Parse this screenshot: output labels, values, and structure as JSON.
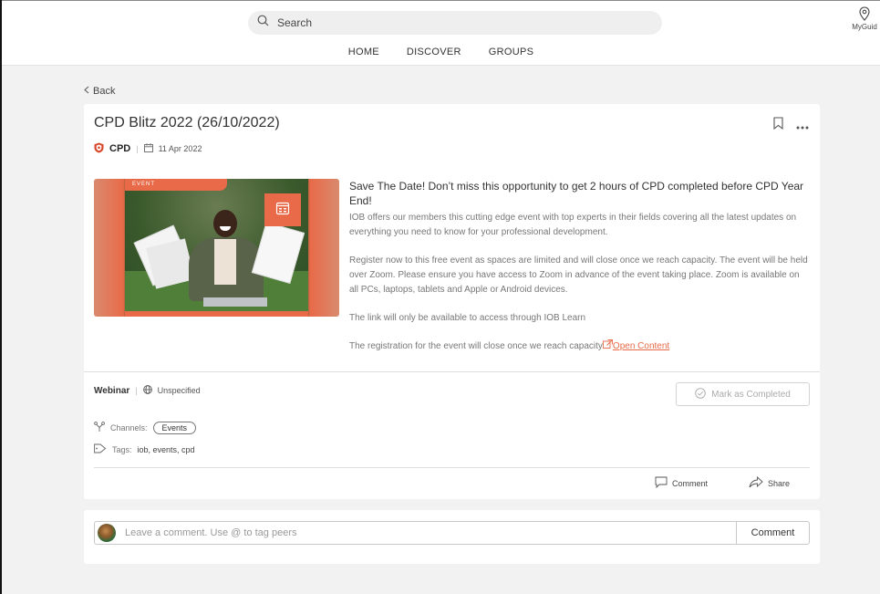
{
  "header": {
    "search_placeholder": "Search",
    "nav": [
      "HOME",
      "DISCOVER",
      "GROUPS"
    ],
    "myguide_label": "MyGuid"
  },
  "back_label": "Back",
  "content": {
    "title": "CPD Blitz 2022 (26/10/2022)",
    "provider": "CPD",
    "date": "11 Apr 2022",
    "image_tag": "EVENT",
    "lead": "Save The Date! Don’t miss this opportunity to get 2 hours of CPD completed before CPD Year End!",
    "paragraphs": [
      "IOB offers our members this cutting edge event with top experts in their fields covering all the latest updates on everything you need to know for your professional development.",
      "Register now to this free event as spaces are limited and will close once we reach capacity. The event will be held over Zoom. Please ensure you have access to Zoom in advance of the event taking place. Zoom is available on all PCs, laptops, tablets and Apple or Android devices.",
      "The link will only be available to access through IOB Learn"
    ],
    "last_line": "The registration for the event will close once we reach capacity",
    "open_content_label": "Open Content",
    "format_type": "Webinar",
    "format_location": "Unspecified",
    "mark_completed_label": "Mark as Completed",
    "channels_label": "Channels:",
    "channel_chip": "Events",
    "tags_label": "Tags:",
    "tags_values": "iob, events, cpd",
    "comment_action": "Comment",
    "share_action": "Share"
  },
  "comment_box": {
    "placeholder": "Leave a comment. Use @ to tag peers",
    "submit_label": "Comment"
  },
  "colors": {
    "accent": "#e86a48",
    "provider_icon": "#d9472b"
  }
}
